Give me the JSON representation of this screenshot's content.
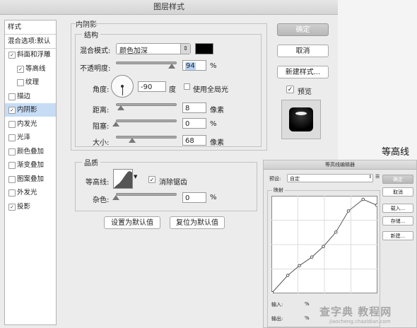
{
  "dialog": {
    "title": "图层样式",
    "style_list": [
      {
        "label": "样式",
        "checkbox": false,
        "checked": false,
        "indent": 0,
        "selected": false
      },
      {
        "label": "混合选项:默认",
        "checkbox": false,
        "checked": false,
        "indent": 0,
        "selected": false
      },
      {
        "label": "斜面和浮雕",
        "checkbox": true,
        "checked": true,
        "indent": 0,
        "selected": false
      },
      {
        "label": "等高线",
        "checkbox": true,
        "checked": true,
        "indent": 1,
        "selected": false
      },
      {
        "label": "纹理",
        "checkbox": true,
        "checked": false,
        "indent": 1,
        "selected": false
      },
      {
        "label": "描边",
        "checkbox": true,
        "checked": false,
        "indent": 0,
        "selected": false
      },
      {
        "label": "内阴影",
        "checkbox": true,
        "checked": true,
        "indent": 0,
        "selected": true
      },
      {
        "label": "内发光",
        "checkbox": true,
        "checked": false,
        "indent": 0,
        "selected": false
      },
      {
        "label": "光泽",
        "checkbox": true,
        "checked": false,
        "indent": 0,
        "selected": false
      },
      {
        "label": "颜色叠加",
        "checkbox": true,
        "checked": false,
        "indent": 0,
        "selected": false
      },
      {
        "label": "渐变叠加",
        "checkbox": true,
        "checked": false,
        "indent": 0,
        "selected": false
      },
      {
        "label": "图案叠加",
        "checkbox": true,
        "checked": false,
        "indent": 0,
        "selected": false
      },
      {
        "label": "外发光",
        "checkbox": true,
        "checked": false,
        "indent": 0,
        "selected": false
      },
      {
        "label": "投影",
        "checkbox": true,
        "checked": true,
        "indent": 0,
        "selected": false
      }
    ],
    "inner_shadow": {
      "section_title": "内阴影",
      "structure_title": "结构",
      "blend_mode_label": "混合模式:",
      "blend_mode_value": "颜色加深",
      "shadow_color": "#000000",
      "opacity_label": "不透明度:",
      "opacity_value": "94",
      "opacity_unit": "%",
      "opacity_level": 94,
      "angle_label": "角度:",
      "angle_value": "-90",
      "angle_unit": "度",
      "global_light_label": "使用全局光",
      "global_light_checked": false,
      "distance_label": "距离:",
      "distance_value": "8",
      "distance_unit": "像素",
      "distance_level": 8,
      "choke_label": "阻塞:",
      "choke_value": "0",
      "choke_unit": "%",
      "choke_level": 0,
      "size_label": "大小:",
      "size_value": "68",
      "size_unit": "像素",
      "size_level": 27,
      "quality_title": "品质",
      "contour_label": "等高线:",
      "antialias_label": "消除锯齿",
      "antialias_checked": true,
      "noise_label": "杂色:",
      "noise_value": "0",
      "noise_unit": "%",
      "noise_level": 0,
      "set_default_label": "设置为默认值",
      "reset_default_label": "复位为默认值"
    },
    "buttons": {
      "ok": "确定",
      "cancel": "取消",
      "new_style": "新建样式...",
      "preview_label": "预览",
      "preview_checked": true
    }
  },
  "side_caption": "等高线",
  "contour_editor": {
    "title": "等高线编辑器",
    "preset_label": "预设:",
    "preset_value": "自定",
    "mapping_title": "映射",
    "input_label": "输入:",
    "input_unit": "%",
    "output_label": "输出:",
    "output_unit": "%",
    "ok": "确定",
    "cancel": "取消",
    "load": "载入...",
    "save": "存储...",
    "new": "新建...",
    "curve_points": [
      [
        0,
        0
      ],
      [
        0.15,
        0.18
      ],
      [
        0.26,
        0.28
      ],
      [
        0.38,
        0.37
      ],
      [
        0.49,
        0.48
      ],
      [
        0.61,
        0.63
      ],
      [
        0.73,
        0.85
      ],
      [
        0.87,
        0.97
      ],
      [
        1.0,
        0.91
      ]
    ]
  },
  "watermark": {
    "line1": "查字典 教程网",
    "line2": "jiaocheng.chazidian.com"
  }
}
